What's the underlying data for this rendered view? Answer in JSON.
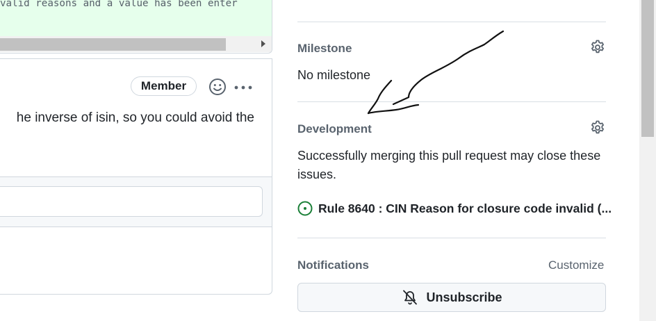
{
  "timeline": {
    "diff_line": "valid reasons and a value has been enter",
    "member_badge": "Member",
    "comment_text": "he inverse of isin, so you could avoid the"
  },
  "sidebar": {
    "milestone": {
      "title": "Milestone",
      "value": "No milestone"
    },
    "development": {
      "title": "Development",
      "description": "Successfully merging this pull request may close these issues.",
      "issue_title": "Rule 8640 : CIN Reason for closure code invalid (..."
    },
    "notifications": {
      "title": "Notifications",
      "customize_label": "Customize",
      "unsubscribe_label": "Unsubscribe"
    }
  },
  "icons": {
    "milestone_gear": "gear-icon",
    "development_gear": "gear-icon",
    "issue_status": "issue-opened-icon",
    "unsubscribe": "bell-slash-icon",
    "emoji": "smiley-icon",
    "more": "kebab-horizontal-icon"
  },
  "colors": {
    "issue_open": "#1a7f37",
    "diff_added_bg": "#e6ffec",
    "muted_text": "#59636e"
  }
}
